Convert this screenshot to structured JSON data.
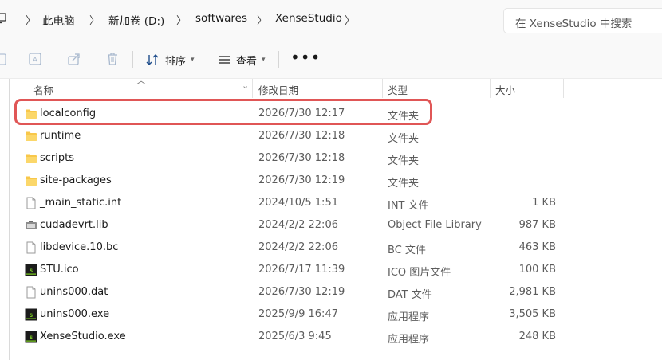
{
  "breadcrumb": {
    "items": [
      "此电脑",
      "新加卷 (D:)",
      "softwares",
      "XenseStudio"
    ]
  },
  "search": {
    "placeholder": "在 XenseStudio 中搜索"
  },
  "toolbar": {
    "sort_label": "排序",
    "view_label": "查看",
    "more_label": "•••"
  },
  "columns": {
    "name": "名称",
    "modified": "修改日期",
    "type": "类型",
    "size": "大小"
  },
  "files": [
    {
      "name": "localconfig",
      "modified": "2026/7/30 12:17",
      "type": "文件夹",
      "size": "",
      "icon": "folder-icon"
    },
    {
      "name": "runtime",
      "modified": "2026/7/30 12:18",
      "type": "文件夹",
      "size": "",
      "icon": "folder-icon"
    },
    {
      "name": "scripts",
      "modified": "2026/7/30 12:18",
      "type": "文件夹",
      "size": "",
      "icon": "folder-icon"
    },
    {
      "name": "site-packages",
      "modified": "2026/7/30 12:19",
      "type": "文件夹",
      "size": "",
      "icon": "folder-icon"
    },
    {
      "name": "_main_static.int",
      "modified": "2024/10/5 1:51",
      "type": "INT 文件",
      "size": "1 KB",
      "icon": "file-icon"
    },
    {
      "name": "cudadevrt.lib",
      "modified": "2024/2/2 22:06",
      "type": "Object File Library",
      "size": "987 KB",
      "icon": "library-icon"
    },
    {
      "name": "libdevice.10.bc",
      "modified": "2024/2/2 22:06",
      "type": "BC 文件",
      "size": "463 KB",
      "icon": "file-icon"
    },
    {
      "name": "STU.ico",
      "modified": "2026/7/17 11:39",
      "type": "ICO 图片文件",
      "size": "100 KB",
      "icon": "app-icon"
    },
    {
      "name": "unins000.dat",
      "modified": "2026/7/30 12:19",
      "type": "DAT 文件",
      "size": "2,981 KB",
      "icon": "file-icon"
    },
    {
      "name": "unins000.exe",
      "modified": "2025/9/9 16:47",
      "type": "应用程序",
      "size": "3,505 KB",
      "icon": "app-icon"
    },
    {
      "name": "XenseStudio.exe",
      "modified": "2025/6/3 9:45",
      "type": "应用程序",
      "size": "248 KB",
      "icon": "app-icon"
    }
  ],
  "colors": {
    "highlight": "#e05656",
    "folder": "#f8c74a",
    "app_icon_bg": "#1b1b1b",
    "app_icon_fg": "#7ed321"
  }
}
